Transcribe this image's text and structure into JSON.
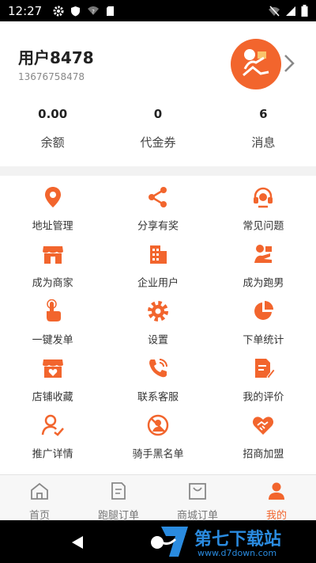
{
  "status_bar": {
    "time": "12:27"
  },
  "profile": {
    "username": "用户8478",
    "phone": "13676758478",
    "stats": [
      {
        "value": "0.00",
        "label": "余额"
      },
      {
        "value": "0",
        "label": "代金券"
      },
      {
        "value": "6",
        "label": "消息"
      }
    ]
  },
  "menu": [
    {
      "label": "地址管理",
      "icon": "location-pin-icon"
    },
    {
      "label": "分享有奖",
      "icon": "share-icon"
    },
    {
      "label": "常见问题",
      "icon": "headset-icon"
    },
    {
      "label": "成为商家",
      "icon": "storefront-icon"
    },
    {
      "label": "企业用户",
      "icon": "building-icon"
    },
    {
      "label": "成为跑男",
      "icon": "courier-icon"
    },
    {
      "label": "一键发单",
      "icon": "touch-hand-icon"
    },
    {
      "label": "设置",
      "icon": "gear-icon"
    },
    {
      "label": "下单统计",
      "icon": "pie-chart-icon"
    },
    {
      "label": "店铺收藏",
      "icon": "store-favorite-icon"
    },
    {
      "label": "联系客服",
      "icon": "phone-call-icon"
    },
    {
      "label": "我的评价",
      "icon": "document-edit-icon"
    },
    {
      "label": "推广详情",
      "icon": "user-check-icon"
    },
    {
      "label": "骑手黑名单",
      "icon": "blocked-user-icon"
    },
    {
      "label": "招商加盟",
      "icon": "handshake-icon"
    }
  ],
  "tabs": [
    {
      "label": "首页",
      "icon": "home-icon",
      "active": false
    },
    {
      "label": "跑腿订单",
      "icon": "order-list-icon",
      "active": false
    },
    {
      "label": "商城订单",
      "icon": "shopping-bag-icon",
      "active": false
    },
    {
      "label": "我的",
      "icon": "person-icon",
      "active": true
    }
  ],
  "watermark": {
    "brand": "第七下载站",
    "url": "www.d7down.com"
  },
  "colors": {
    "accent": "#f2652d",
    "watermark": "#2a8be0"
  }
}
